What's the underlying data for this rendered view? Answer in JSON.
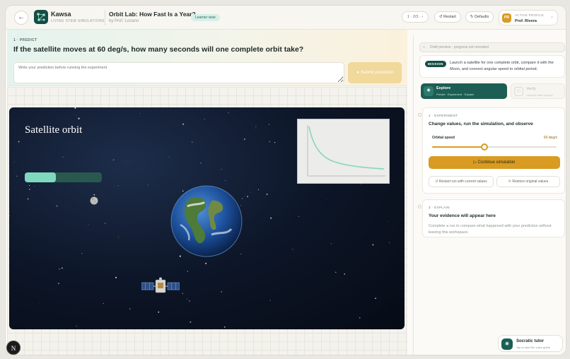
{
  "header": {
    "back_icon": "arrow-left-icon",
    "brand_name": "Kawsa",
    "brand_tagline": "LIVING STEM SIMULATIONS",
    "lesson_title": "Orbit Lab: How Fast Is a Year?",
    "lesson_author": "by Prof. Lozano",
    "view_badge": "Learner view",
    "pager": "1 · 2/3 ·",
    "restart_label": "Restart",
    "defaults_label": "Defaults",
    "profile": {
      "initials": "PR",
      "label": "ACTIVE PROFILE",
      "name": "Prof. Rivera"
    }
  },
  "predict": {
    "step": "1 · PREDICT",
    "question": "If the satellite moves at 60 deg/s, how many seconds will one complete orbit take?",
    "placeholder": "Write your prediction before running the experiment",
    "submit_label": "Submit prediction"
  },
  "simulation": {
    "title": "Satellite orbit",
    "progress_fraction": 0.4
  },
  "rail": {
    "draft_text": "Draft preview · progress not recorded",
    "mission_tag": "MISSION",
    "mission_text": "Launch a satellite for one complete orbit, compare it with the Moon, and connect angular speed to orbital period.",
    "stages": [
      {
        "title": "Explore",
        "subtitle": "Predict · Experiment · Explain"
      },
      {
        "title": "Verify",
        "subtitle": "Unlocks after explore"
      }
    ],
    "experiment": {
      "step": "2 · EXPERIMENT",
      "title": "Change values, run the simulation, and observe",
      "speed_label": "Orbital speed",
      "speed_value": "60 deg/s",
      "slider_fraction": 0.42,
      "continue_label": "Continue simulation",
      "restart_label": "Restart run with current values",
      "restore_label": "Restore original values"
    },
    "explain": {
      "step": "3 · EXPLAIN",
      "title": "Your evidence will appear here",
      "description": "Complete a run to compare what happened with your prediction without leaving this workspace."
    }
  },
  "tutor": {
    "title": "Socratic tutor",
    "subtitle": "Tap to start the voice guide"
  },
  "corner_badge": "N",
  "colors": {
    "accent_teal": "#1d5e54",
    "accent_gold": "#d99b22",
    "mint": "#7ed8bd",
    "space": "#0d1628"
  }
}
